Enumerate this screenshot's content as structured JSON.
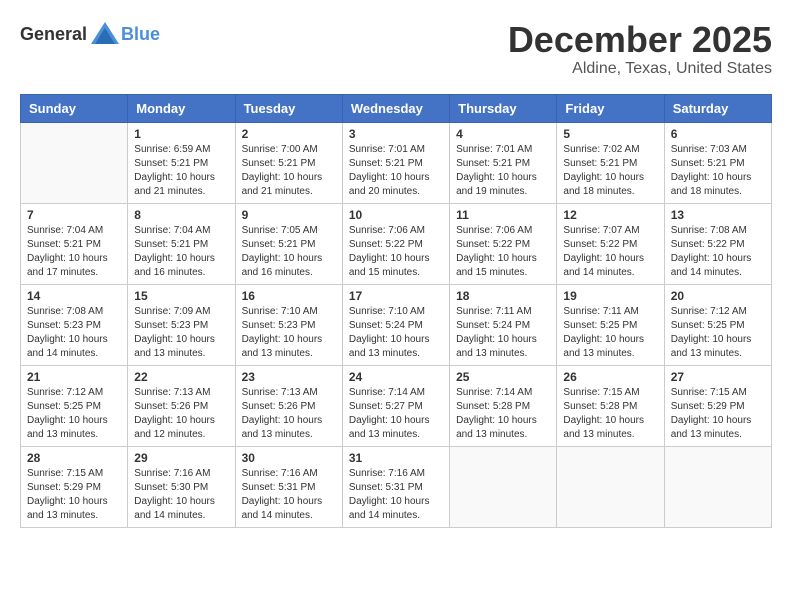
{
  "header": {
    "logo_general": "General",
    "logo_blue": "Blue",
    "month": "December 2025",
    "location": "Aldine, Texas, United States"
  },
  "days_of_week": [
    "Sunday",
    "Monday",
    "Tuesday",
    "Wednesday",
    "Thursday",
    "Friday",
    "Saturday"
  ],
  "weeks": [
    [
      {
        "day": "",
        "info": ""
      },
      {
        "day": "1",
        "info": "Sunrise: 6:59 AM\nSunset: 5:21 PM\nDaylight: 10 hours\nand 21 minutes."
      },
      {
        "day": "2",
        "info": "Sunrise: 7:00 AM\nSunset: 5:21 PM\nDaylight: 10 hours\nand 21 minutes."
      },
      {
        "day": "3",
        "info": "Sunrise: 7:01 AM\nSunset: 5:21 PM\nDaylight: 10 hours\nand 20 minutes."
      },
      {
        "day": "4",
        "info": "Sunrise: 7:01 AM\nSunset: 5:21 PM\nDaylight: 10 hours\nand 19 minutes."
      },
      {
        "day": "5",
        "info": "Sunrise: 7:02 AM\nSunset: 5:21 PM\nDaylight: 10 hours\nand 18 minutes."
      },
      {
        "day": "6",
        "info": "Sunrise: 7:03 AM\nSunset: 5:21 PM\nDaylight: 10 hours\nand 18 minutes."
      }
    ],
    [
      {
        "day": "7",
        "info": "Sunrise: 7:04 AM\nSunset: 5:21 PM\nDaylight: 10 hours\nand 17 minutes."
      },
      {
        "day": "8",
        "info": "Sunrise: 7:04 AM\nSunset: 5:21 PM\nDaylight: 10 hours\nand 16 minutes."
      },
      {
        "day": "9",
        "info": "Sunrise: 7:05 AM\nSunset: 5:21 PM\nDaylight: 10 hours\nand 16 minutes."
      },
      {
        "day": "10",
        "info": "Sunrise: 7:06 AM\nSunset: 5:22 PM\nDaylight: 10 hours\nand 15 minutes."
      },
      {
        "day": "11",
        "info": "Sunrise: 7:06 AM\nSunset: 5:22 PM\nDaylight: 10 hours\nand 15 minutes."
      },
      {
        "day": "12",
        "info": "Sunrise: 7:07 AM\nSunset: 5:22 PM\nDaylight: 10 hours\nand 14 minutes."
      },
      {
        "day": "13",
        "info": "Sunrise: 7:08 AM\nSunset: 5:22 PM\nDaylight: 10 hours\nand 14 minutes."
      }
    ],
    [
      {
        "day": "14",
        "info": "Sunrise: 7:08 AM\nSunset: 5:23 PM\nDaylight: 10 hours\nand 14 minutes."
      },
      {
        "day": "15",
        "info": "Sunrise: 7:09 AM\nSunset: 5:23 PM\nDaylight: 10 hours\nand 13 minutes."
      },
      {
        "day": "16",
        "info": "Sunrise: 7:10 AM\nSunset: 5:23 PM\nDaylight: 10 hours\nand 13 minutes."
      },
      {
        "day": "17",
        "info": "Sunrise: 7:10 AM\nSunset: 5:24 PM\nDaylight: 10 hours\nand 13 minutes."
      },
      {
        "day": "18",
        "info": "Sunrise: 7:11 AM\nSunset: 5:24 PM\nDaylight: 10 hours\nand 13 minutes."
      },
      {
        "day": "19",
        "info": "Sunrise: 7:11 AM\nSunset: 5:25 PM\nDaylight: 10 hours\nand 13 minutes."
      },
      {
        "day": "20",
        "info": "Sunrise: 7:12 AM\nSunset: 5:25 PM\nDaylight: 10 hours\nand 13 minutes."
      }
    ],
    [
      {
        "day": "21",
        "info": "Sunrise: 7:12 AM\nSunset: 5:25 PM\nDaylight: 10 hours\nand 13 minutes."
      },
      {
        "day": "22",
        "info": "Sunrise: 7:13 AM\nSunset: 5:26 PM\nDaylight: 10 hours\nand 12 minutes."
      },
      {
        "day": "23",
        "info": "Sunrise: 7:13 AM\nSunset: 5:26 PM\nDaylight: 10 hours\nand 13 minutes."
      },
      {
        "day": "24",
        "info": "Sunrise: 7:14 AM\nSunset: 5:27 PM\nDaylight: 10 hours\nand 13 minutes."
      },
      {
        "day": "25",
        "info": "Sunrise: 7:14 AM\nSunset: 5:28 PM\nDaylight: 10 hours\nand 13 minutes."
      },
      {
        "day": "26",
        "info": "Sunrise: 7:15 AM\nSunset: 5:28 PM\nDaylight: 10 hours\nand 13 minutes."
      },
      {
        "day": "27",
        "info": "Sunrise: 7:15 AM\nSunset: 5:29 PM\nDaylight: 10 hours\nand 13 minutes."
      }
    ],
    [
      {
        "day": "28",
        "info": "Sunrise: 7:15 AM\nSunset: 5:29 PM\nDaylight: 10 hours\nand 13 minutes."
      },
      {
        "day": "29",
        "info": "Sunrise: 7:16 AM\nSunset: 5:30 PM\nDaylight: 10 hours\nand 14 minutes."
      },
      {
        "day": "30",
        "info": "Sunrise: 7:16 AM\nSunset: 5:31 PM\nDaylight: 10 hours\nand 14 minutes."
      },
      {
        "day": "31",
        "info": "Sunrise: 7:16 AM\nSunset: 5:31 PM\nDaylight: 10 hours\nand 14 minutes."
      },
      {
        "day": "",
        "info": ""
      },
      {
        "day": "",
        "info": ""
      },
      {
        "day": "",
        "info": ""
      }
    ]
  ]
}
